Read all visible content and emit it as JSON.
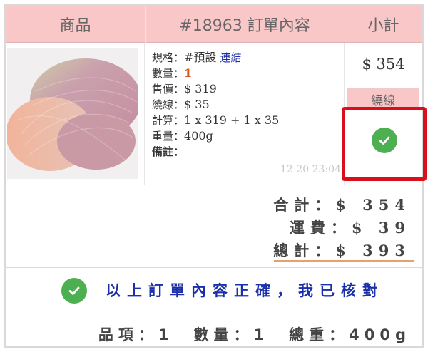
{
  "header": {
    "col_product": "商品",
    "col_order": "#18963 訂單內容",
    "col_subtotal": "小計"
  },
  "item": {
    "spec_label": "規格：",
    "spec_value": "#預設",
    "spec_link": "連結",
    "qty_label": "數量：",
    "qty_value": "1",
    "price_label": "售價：",
    "price_value": "$ 319",
    "winding_label": "繞線：",
    "winding_value": "$ 35",
    "calc_label": "計算：",
    "calc_value": "1 x 319 + 1 x 35",
    "weight_label": "重量：",
    "weight_value": "400g",
    "note_label": "備註：",
    "timestamp": "12-20 23:04",
    "subtotal": "$ 354",
    "winding_tag": "繞線"
  },
  "totals": {
    "sum_label": "合計：",
    "sum_value": "$ 354",
    "shipping_label": "運費：",
    "shipping_value": "$ 39",
    "grand_label": "總計：",
    "grand_value": "$ 393"
  },
  "confirm": {
    "text": "以上訂單內容正確，我已核對",
    "icon": "check-circle-icon"
  },
  "summary": {
    "text": "品項：1　數量：1　總重：400g"
  },
  "colors": {
    "header_bg": "#f9c7c7",
    "link": "#1a2fa8",
    "qty": "#d9531e",
    "check": "#4db050",
    "highlight_box": "#d80f1c",
    "total_underline": "#e8a06d"
  }
}
